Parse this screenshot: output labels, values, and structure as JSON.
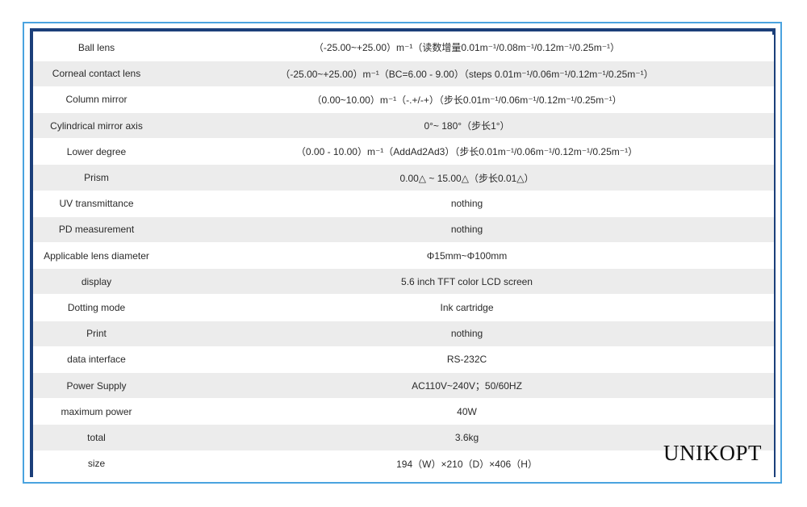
{
  "brand": "UNIKOPT",
  "rows": [
    {
      "label": "Ball lens",
      "value": "（-25.00~+25.00）m⁻¹（读数增量0.01m⁻¹/0.08m⁻¹/0.12m⁻¹/0.25m⁻¹）"
    },
    {
      "label": "Corneal contact lens",
      "value": "（-25.00~+25.00）m⁻¹（BC=6.00 - 9.00）（steps 0.01m⁻¹/0.06m⁻¹/0.12m⁻¹/0.25m⁻¹）"
    },
    {
      "label": "Column mirror",
      "value": "（0.00~10.00）m⁻¹（-.+/-+）（步长0.01m⁻¹/0.06m⁻¹/0.12m⁻¹/0.25m⁻¹）"
    },
    {
      "label": "Cylindrical mirror axis",
      "value": "0°~ 180°（步长1°）"
    },
    {
      "label": "Lower degree",
      "value": "（0.00 - 10.00）m⁻¹（AddAd2Ad3）（步长0.01m⁻¹/0.06m⁻¹/0.12m⁻¹/0.25m⁻¹）"
    },
    {
      "label": "Prism",
      "value": "0.00△ ~ 15.00△（步长0.01△）"
    },
    {
      "label": "UV transmittance",
      "value": "nothing"
    },
    {
      "label": "PD measurement",
      "value": "nothing"
    },
    {
      "label": "Applicable lens diameter",
      "value": "Φ15mm~Φ100mm"
    },
    {
      "label": "display",
      "value": "5.6 inch TFT color LCD screen"
    },
    {
      "label": "Dotting mode",
      "value": "Ink cartridge"
    },
    {
      "label": "Print",
      "value": "nothing"
    },
    {
      "label": "data interface",
      "value": "RS-232C"
    },
    {
      "label": "Power Supply",
      "value": "AC110V~240V；50/60HZ"
    },
    {
      "label": "maximum power",
      "value": "40W"
    },
    {
      "label": "total",
      "value": "3.6kg"
    },
    {
      "label": "size",
      "value": "194（W）×210（D）×406（H）"
    }
  ]
}
